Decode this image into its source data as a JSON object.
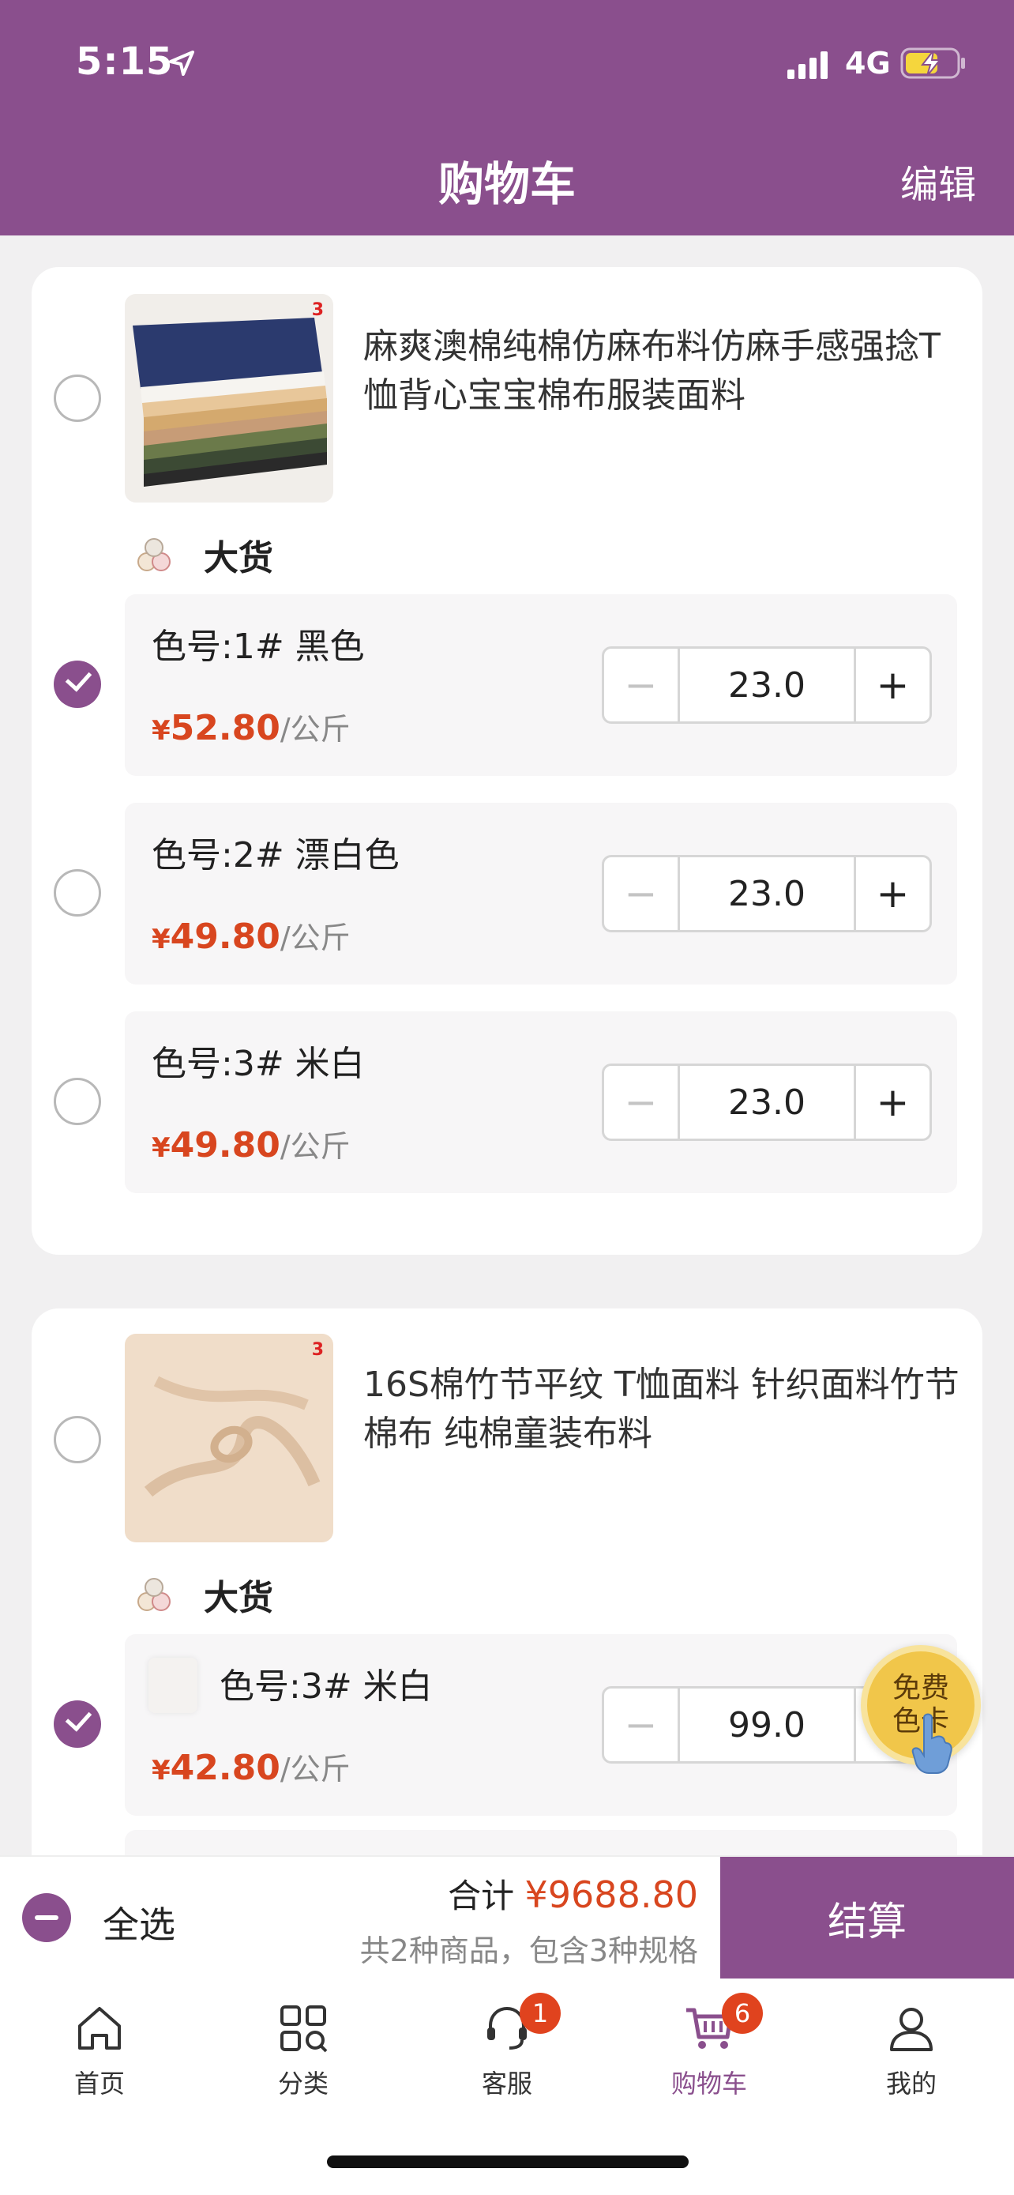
{
  "status_bar": {
    "time": "5:15",
    "network": "4G"
  },
  "nav": {
    "title": "购物车",
    "edit_label": "编辑"
  },
  "products": [
    {
      "title": "麻爽澳棉纯棉仿麻布料仿麻手感强捻T恤背心宝宝棉布服装面料",
      "tag_label": "大货",
      "skus": [
        {
          "name": "色号:1# 黑色",
          "yen": "¥",
          "price": "52.80",
          "unit": "/公斤",
          "quantity": "23.0",
          "checked": true
        },
        {
          "name": "色号:2# 漂白色",
          "yen": "¥",
          "price": "49.80",
          "unit": "/公斤",
          "quantity": "23.0",
          "checked": false
        },
        {
          "name": "色号:3# 米白",
          "yen": "¥",
          "price": "49.80",
          "unit": "/公斤",
          "quantity": "23.0",
          "checked": false
        }
      ]
    },
    {
      "title": "16S棉竹节平纹 T恤面料 针织面料竹节棉布 纯棉童装布料",
      "tag_label": "大货",
      "skus": [
        {
          "name": "色号:3# 米白",
          "yen": "¥",
          "price": "42.80",
          "unit": "/公斤",
          "quantity": "99.0",
          "checked": true
        }
      ]
    }
  ],
  "stepper": {
    "minus": "−",
    "plus": "+"
  },
  "free_card": {
    "line1": "免费",
    "line2": "色卡"
  },
  "checkout": {
    "select_all_label": "全选",
    "total_label": "合计",
    "total_amount": "¥9688.80",
    "summary": "共2种商品，包含3种规格",
    "settle_label": "结算"
  },
  "tabs": [
    {
      "label": "首页",
      "icon": "home-icon"
    },
    {
      "label": "分类",
      "icon": "category-icon"
    },
    {
      "label": "客服",
      "icon": "customer-service-icon",
      "badge": "1"
    },
    {
      "label": "购物车",
      "icon": "cart-icon",
      "badge": "6",
      "active": true
    },
    {
      "label": "我的",
      "icon": "profile-icon"
    }
  ],
  "colors": {
    "brand": "#8a4f8d",
    "price": "#d8461f",
    "badge": "#e0431e"
  }
}
